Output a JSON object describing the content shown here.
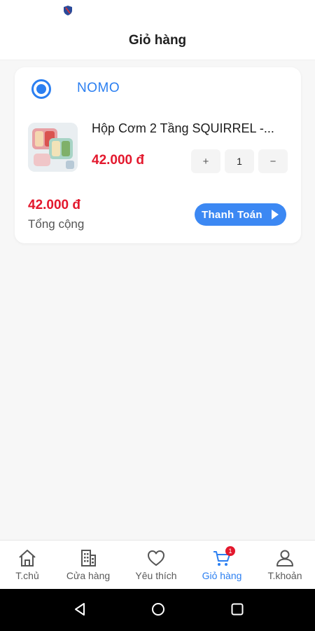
{
  "header": {
    "title": "Giỏ hàng"
  },
  "shop": {
    "name": "NOMO",
    "selected": true
  },
  "product": {
    "name": "Hộp Cơm 2 Tầng SQUIRREL -...",
    "price": "42.000 đ",
    "qty_plus": "+",
    "qty_value": "1",
    "qty_minus": "−"
  },
  "summary": {
    "total_amount": "42.000 đ",
    "total_label": "Tổng cộng",
    "checkout_label": "Thanh Toán"
  },
  "bottom_nav": {
    "items": [
      {
        "label": "T.chủ",
        "icon": "home-icon"
      },
      {
        "label": "Cửa hàng",
        "icon": "store-icon"
      },
      {
        "label": "Yêu thích",
        "icon": "heart-icon"
      },
      {
        "label": "Giỏ hàng",
        "icon": "cart-icon",
        "badge": "1",
        "active": true
      },
      {
        "label": "T.khoản",
        "icon": "user-icon"
      }
    ]
  },
  "colors": {
    "accent": "#2b7ff1",
    "price": "#e3182d",
    "checkout_button": "#3c88f3"
  }
}
